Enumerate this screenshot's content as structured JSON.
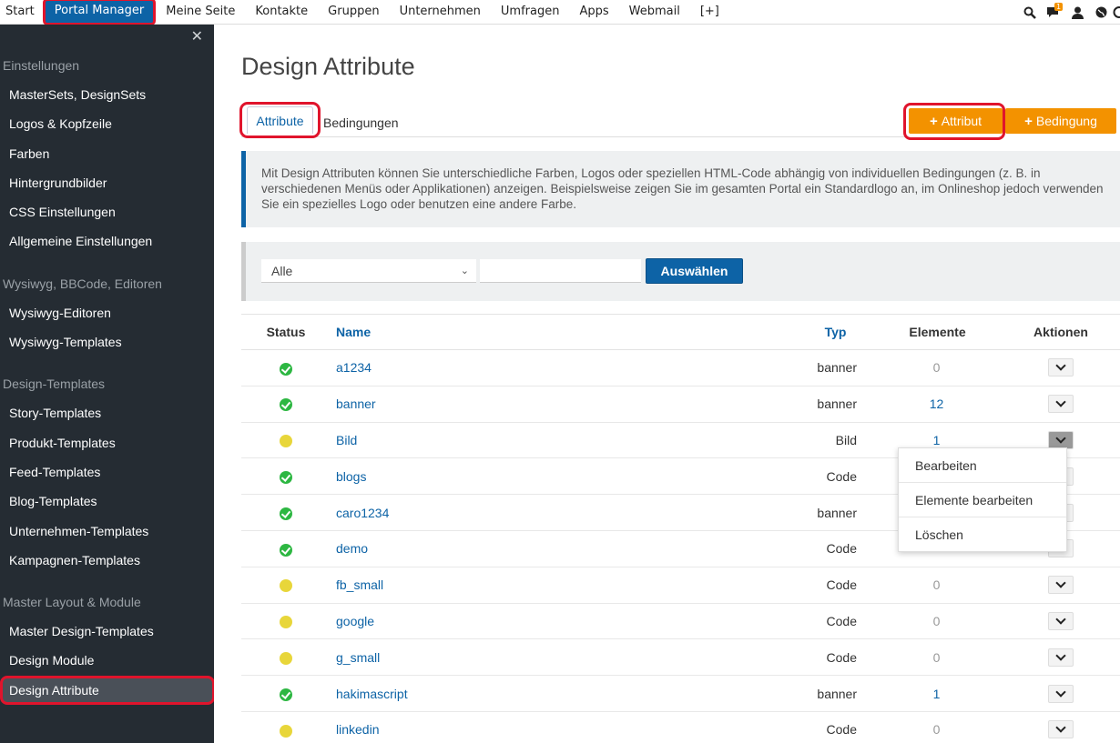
{
  "topnav": {
    "items": [
      "Start",
      "Portal Manager",
      "Meine Seite",
      "Kontakte",
      "Gruppen",
      "Unternehmen",
      "Umfragen",
      "Apps",
      "Webmail",
      "[+]"
    ],
    "notification_count": "1"
  },
  "sidebar": {
    "sections": [
      {
        "title": "Einstellungen",
        "items": [
          "MasterSets, DesignSets",
          "Logos & Kopfzeile",
          "Farben",
          "Hintergrundbilder",
          "CSS Einstellungen",
          "Allgemeine Einstellungen"
        ]
      },
      {
        "title": "Wysiwyg, BBCode, Editoren",
        "items": [
          "Wysiwyg-Editoren",
          "Wysiwyg-Templates"
        ]
      },
      {
        "title": "Design-Templates",
        "items": [
          "Story-Templates",
          "Produkt-Templates",
          "Feed-Templates",
          "Blog-Templates",
          "Unternehmen-Templates",
          "Kampagnen-Templates"
        ]
      },
      {
        "title": "Master Layout & Module",
        "items": [
          "Master Design-Templates",
          "Design Module",
          "Design Attribute"
        ]
      }
    ]
  },
  "page": {
    "title": "Design Attribute",
    "tabs": [
      "Attribute",
      "Bedingungen"
    ],
    "add_attribut": "Attribut",
    "add_bedingung": "Bedingung",
    "info": "Mit Design Attributen können Sie unterschiedliche Farben, Logos oder speziellen HTML-Code abhängig von individuellen Bedingungen (z. B. in verschiedenen Menüs oder Applikationen) anzeigen. Beispielsweise zeigen Sie im gesamten Portal ein Standardlogo an, im Onlineshop jedoch verwenden Sie ein spezielles Logo oder benutzen eine andere Farbe.",
    "filter_select": "Alle",
    "filter_button": "Auswählen"
  },
  "table": {
    "headers": {
      "status": "Status",
      "name": "Name",
      "typ": "Typ",
      "elemente": "Elemente",
      "aktionen": "Aktionen"
    },
    "rows": [
      {
        "status": "active",
        "name": "a1234",
        "typ": "banner",
        "elemente": "0"
      },
      {
        "status": "active",
        "name": "banner",
        "typ": "banner",
        "elemente": "12"
      },
      {
        "status": "inactive",
        "name": "Bild",
        "typ": "Bild",
        "elemente": "1"
      },
      {
        "status": "active",
        "name": "blogs",
        "typ": "Code",
        "elemente": ""
      },
      {
        "status": "active",
        "name": "caro1234",
        "typ": "banner",
        "elemente": ""
      },
      {
        "status": "active",
        "name": "demo",
        "typ": "Code",
        "elemente": ""
      },
      {
        "status": "inactive",
        "name": "fb_small",
        "typ": "Code",
        "elemente": "0"
      },
      {
        "status": "inactive",
        "name": "google",
        "typ": "Code",
        "elemente": "0"
      },
      {
        "status": "inactive",
        "name": "g_small",
        "typ": "Code",
        "elemente": "0"
      },
      {
        "status": "active",
        "name": "hakimascript",
        "typ": "banner",
        "elemente": "1"
      },
      {
        "status": "inactive",
        "name": "linkedin",
        "typ": "Code",
        "elemente": "0"
      }
    ],
    "open_menu_row": 2
  },
  "actions_menu": [
    "Bearbeiten",
    "Elemente bearbeiten",
    "Löschen"
  ],
  "colors": {
    "accent": "#0d63a6",
    "orange": "#f39200",
    "sidebar_bg": "#252c33",
    "highlight": "#e0142c"
  }
}
